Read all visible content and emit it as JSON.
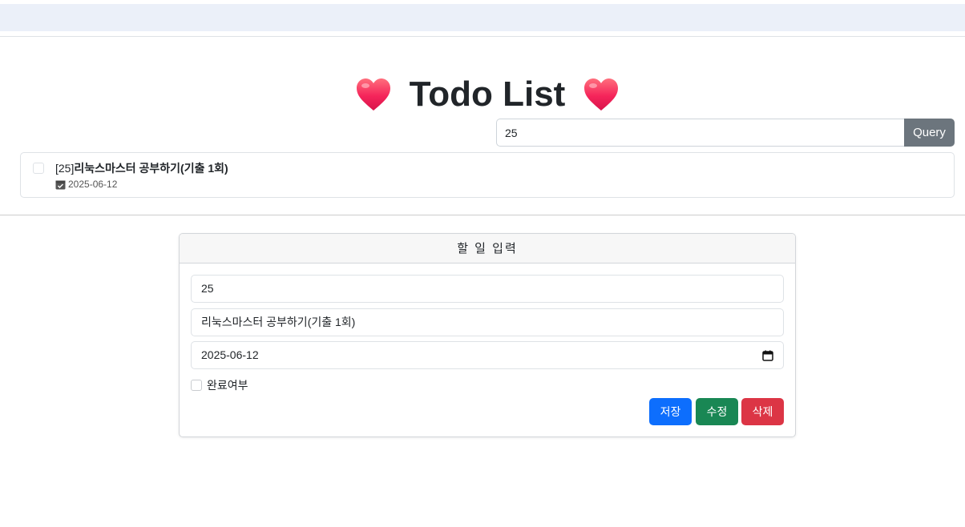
{
  "header": {
    "title": "Todo List",
    "heart_icon": "heart-icon"
  },
  "search": {
    "value": "25",
    "button_label": "Query"
  },
  "todos": [
    {
      "id_prefix": "[25]",
      "title": "리눅스마스터 공부하기(기출 1회)",
      "date": "2025-06-12",
      "done": false
    }
  ],
  "form": {
    "header": "할 일 입력",
    "id_value": "25",
    "title_value": "리눅스마스터 공부하기(기출 1회)",
    "date_value": "2025-06-12",
    "done_label": "완료여부",
    "save_label": "저장",
    "edit_label": "수정",
    "delete_label": "삭제"
  },
  "colors": {
    "topbar": "#ebf0f9",
    "query_button": "#6c757d",
    "save": "#0d6efd",
    "edit": "#198754",
    "delete": "#dc3545",
    "heart": "#f5245a"
  }
}
